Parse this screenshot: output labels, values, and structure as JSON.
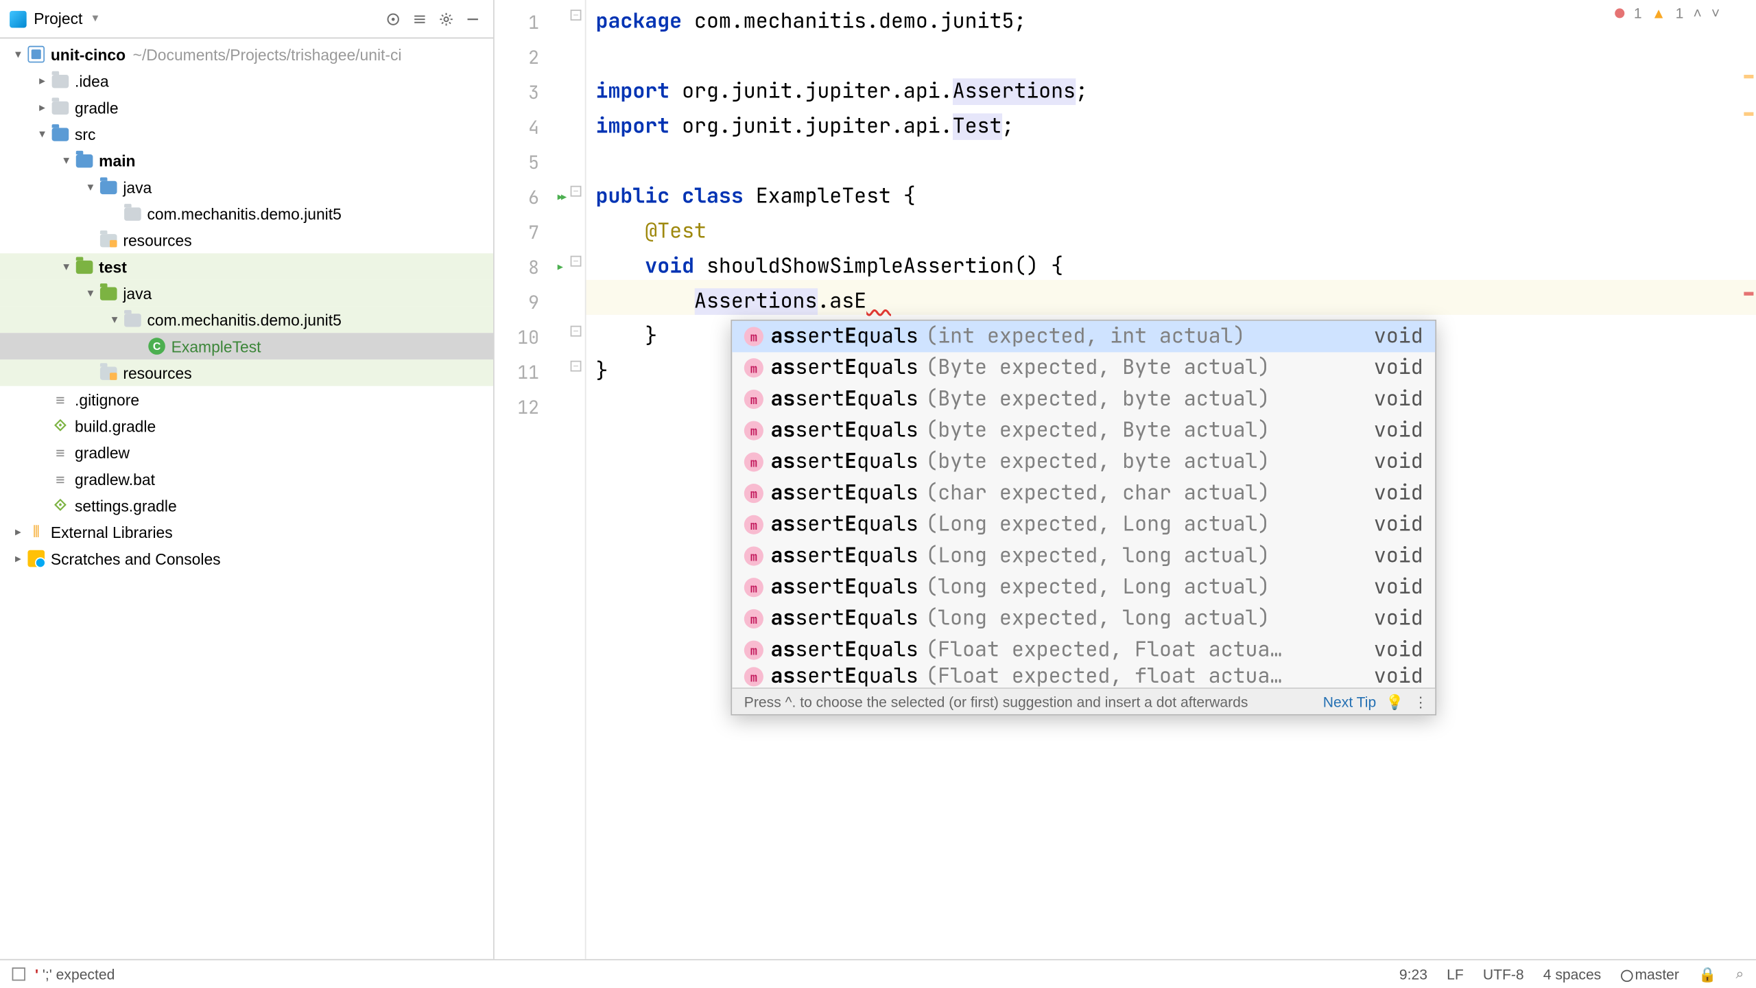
{
  "project_panel": {
    "header_label": "Project",
    "tree": [
      {
        "indent": 0,
        "arrow": "down",
        "icon": "module",
        "label": "unit-cinco",
        "bold": true,
        "extra": "~/Documents/Projects/trishagee/unit-ci"
      },
      {
        "indent": 1,
        "arrow": "right",
        "icon": "folder-gen",
        "label": ".idea"
      },
      {
        "indent": 1,
        "arrow": "right",
        "icon": "folder-gen",
        "label": "gradle"
      },
      {
        "indent": 1,
        "arrow": "down",
        "icon": "folder-blue",
        "label": "src"
      },
      {
        "indent": 2,
        "arrow": "down",
        "icon": "folder-blue",
        "label": "main",
        "bold": true
      },
      {
        "indent": 3,
        "arrow": "down",
        "icon": "folder-blue",
        "label": "java"
      },
      {
        "indent": 4,
        "arrow": "none",
        "icon": "folder-gen",
        "label": "com.mechanitis.demo.junit5"
      },
      {
        "indent": 3,
        "arrow": "none",
        "icon": "folder-res",
        "label": "resources"
      },
      {
        "indent": 2,
        "arrow": "down",
        "icon": "folder-green",
        "label": "test",
        "bold": true,
        "row_class": "sel-test"
      },
      {
        "indent": 3,
        "arrow": "down",
        "icon": "folder-green",
        "label": "java",
        "row_class": "sel-test"
      },
      {
        "indent": 4,
        "arrow": "down",
        "icon": "folder-gen",
        "label": "com.mechanitis.demo.junit5",
        "row_class": "sel-test"
      },
      {
        "indent": 5,
        "arrow": "none",
        "icon": "class",
        "label": "ExampleTest",
        "label_class": "testclr",
        "row_class": "sel"
      },
      {
        "indent": 3,
        "arrow": "none",
        "icon": "folder-res",
        "label": "resources",
        "row_class": "sel-test"
      },
      {
        "indent": 1,
        "arrow": "none",
        "icon": "file-generic",
        "label": ".gitignore"
      },
      {
        "indent": 1,
        "arrow": "none",
        "icon": "file-gradle",
        "label": "build.gradle"
      },
      {
        "indent": 1,
        "arrow": "none",
        "icon": "file-generic",
        "label": "gradlew"
      },
      {
        "indent": 1,
        "arrow": "none",
        "icon": "file-generic",
        "label": "gradlew.bat"
      },
      {
        "indent": 1,
        "arrow": "none",
        "icon": "file-gradle",
        "label": "settings.gradle"
      },
      {
        "indent": 0,
        "arrow": "right",
        "icon": "libs",
        "label": "External Libraries"
      },
      {
        "indent": 0,
        "arrow": "right",
        "icon": "scratch",
        "label": "Scratches and Consoles"
      }
    ]
  },
  "editor": {
    "lines": [
      "1",
      "2",
      "3",
      "4",
      "5",
      "6",
      "7",
      "8",
      "9",
      "10",
      "11",
      "12"
    ],
    "run_markers": {
      "6": "double",
      "8": "single"
    },
    "highlight_line_index": 8,
    "code_tokens": [
      [
        {
          "t": "package ",
          "c": "kw"
        },
        {
          "t": "com.mechanitis.demo.junit5;"
        }
      ],
      [],
      [
        {
          "t": "import ",
          "c": "kw"
        },
        {
          "t": "org.junit.jupiter.api."
        },
        {
          "t": "Assertions",
          "c": "hl"
        },
        {
          "t": ";"
        }
      ],
      [
        {
          "t": "import ",
          "c": "kw"
        },
        {
          "t": "org.junit.jupiter.api."
        },
        {
          "t": "Test",
          "c": "hl"
        },
        {
          "t": ";"
        }
      ],
      [],
      [
        {
          "t": "public class ",
          "c": "kw"
        },
        {
          "t": "ExampleTest {"
        }
      ],
      [
        {
          "t": "    "
        },
        {
          "t": "@Test",
          "c": "at"
        }
      ],
      [
        {
          "t": "    "
        },
        {
          "t": "void ",
          "c": "kw"
        },
        {
          "t": "shouldShowSimpleAssertion() {"
        }
      ],
      [
        {
          "t": "        "
        },
        {
          "t": "Assertions",
          "c": "hl"
        },
        {
          "t": ".asE",
          "c": ""
        },
        {
          "t": "  ",
          "c": "err"
        }
      ],
      [
        {
          "t": "    }"
        }
      ],
      [
        {
          "t": "}"
        }
      ],
      []
    ],
    "error_count": "1",
    "warn_count": "1"
  },
  "completion": {
    "items": [
      {
        "name": "assertEquals",
        "params": "(int expected, int actual)",
        "return": "void",
        "sel": true
      },
      {
        "name": "assertEquals",
        "params": "(Byte expected, Byte actual)",
        "return": "void"
      },
      {
        "name": "assertEquals",
        "params": "(Byte expected, byte actual)",
        "return": "void"
      },
      {
        "name": "assertEquals",
        "params": "(byte expected, Byte actual)",
        "return": "void"
      },
      {
        "name": "assertEquals",
        "params": "(byte expected, byte actual)",
        "return": "void"
      },
      {
        "name": "assertEquals",
        "params": "(char expected, char actual)",
        "return": "void"
      },
      {
        "name": "assertEquals",
        "params": "(Long expected, Long actual)",
        "return": "void"
      },
      {
        "name": "assertEquals",
        "params": "(Long expected, long actual)",
        "return": "void"
      },
      {
        "name": "assertEquals",
        "params": "(long expected, Long actual)",
        "return": "void"
      },
      {
        "name": "assertEquals",
        "params": "(long expected, long actual)",
        "return": "void"
      },
      {
        "name": "assertEquals",
        "params": "(Float expected, Float actua…",
        "return": "void"
      },
      {
        "name": "assertEquals",
        "params": "(Float expected, float actua…",
        "return": "void",
        "half": true
      }
    ],
    "footer_tip": "Press ^. to choose the selected (or first) suggestion and insert a dot afterwards",
    "next_tip": "Next Tip"
  },
  "status": {
    "left_msg": "';' expected",
    "pos": "9:23",
    "eol": "LF",
    "enc": "UTF-8",
    "indent": "4 spaces",
    "branch": "master"
  }
}
